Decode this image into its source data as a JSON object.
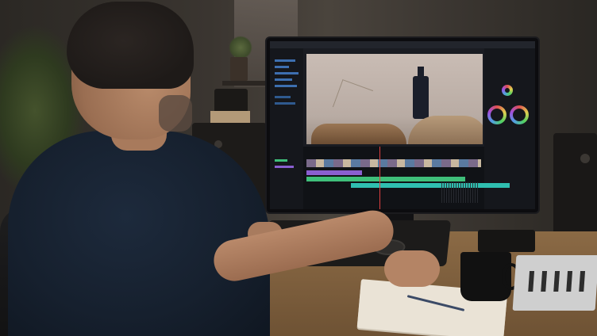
{
  "scene": {
    "subject": "person-editing-video",
    "palette": {
      "wall": "#3a3530",
      "desk": "#8b6a45",
      "shirt": "#1d2a3c",
      "screen_bg": "#1a1c22",
      "accent_blue": "#3d6fb0",
      "timeline_green": "#3fbf7a",
      "timeline_purple": "#8a5fd0"
    },
    "icons": [
      "color-wheel-icon",
      "playhead-marker",
      "mug-icon",
      "pen-icon"
    ]
  }
}
